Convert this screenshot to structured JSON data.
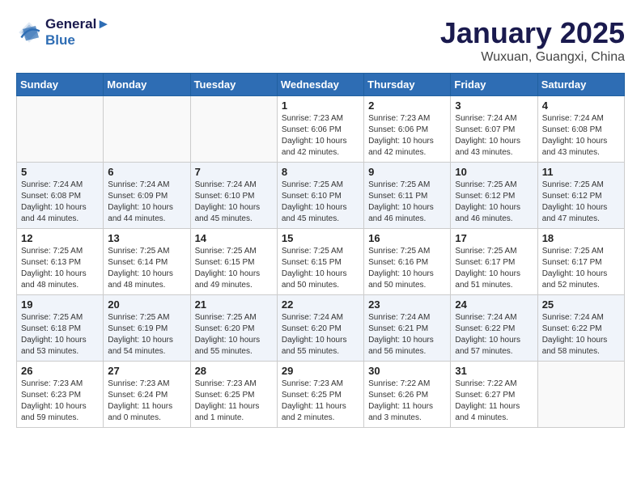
{
  "header": {
    "logo_line1": "General",
    "logo_line2": "Blue",
    "month": "January 2025",
    "location": "Wuxuan, Guangxi, China"
  },
  "weekdays": [
    "Sunday",
    "Monday",
    "Tuesday",
    "Wednesday",
    "Thursday",
    "Friday",
    "Saturday"
  ],
  "weeks": [
    [
      {
        "day": "",
        "info": ""
      },
      {
        "day": "",
        "info": ""
      },
      {
        "day": "",
        "info": ""
      },
      {
        "day": "1",
        "info": "Sunrise: 7:23 AM\nSunset: 6:06 PM\nDaylight: 10 hours\nand 42 minutes."
      },
      {
        "day": "2",
        "info": "Sunrise: 7:23 AM\nSunset: 6:06 PM\nDaylight: 10 hours\nand 42 minutes."
      },
      {
        "day": "3",
        "info": "Sunrise: 7:24 AM\nSunset: 6:07 PM\nDaylight: 10 hours\nand 43 minutes."
      },
      {
        "day": "4",
        "info": "Sunrise: 7:24 AM\nSunset: 6:08 PM\nDaylight: 10 hours\nand 43 minutes."
      }
    ],
    [
      {
        "day": "5",
        "info": "Sunrise: 7:24 AM\nSunset: 6:08 PM\nDaylight: 10 hours\nand 44 minutes."
      },
      {
        "day": "6",
        "info": "Sunrise: 7:24 AM\nSunset: 6:09 PM\nDaylight: 10 hours\nand 44 minutes."
      },
      {
        "day": "7",
        "info": "Sunrise: 7:24 AM\nSunset: 6:10 PM\nDaylight: 10 hours\nand 45 minutes."
      },
      {
        "day": "8",
        "info": "Sunrise: 7:25 AM\nSunset: 6:10 PM\nDaylight: 10 hours\nand 45 minutes."
      },
      {
        "day": "9",
        "info": "Sunrise: 7:25 AM\nSunset: 6:11 PM\nDaylight: 10 hours\nand 46 minutes."
      },
      {
        "day": "10",
        "info": "Sunrise: 7:25 AM\nSunset: 6:12 PM\nDaylight: 10 hours\nand 46 minutes."
      },
      {
        "day": "11",
        "info": "Sunrise: 7:25 AM\nSunset: 6:12 PM\nDaylight: 10 hours\nand 47 minutes."
      }
    ],
    [
      {
        "day": "12",
        "info": "Sunrise: 7:25 AM\nSunset: 6:13 PM\nDaylight: 10 hours\nand 48 minutes."
      },
      {
        "day": "13",
        "info": "Sunrise: 7:25 AM\nSunset: 6:14 PM\nDaylight: 10 hours\nand 48 minutes."
      },
      {
        "day": "14",
        "info": "Sunrise: 7:25 AM\nSunset: 6:15 PM\nDaylight: 10 hours\nand 49 minutes."
      },
      {
        "day": "15",
        "info": "Sunrise: 7:25 AM\nSunset: 6:15 PM\nDaylight: 10 hours\nand 50 minutes."
      },
      {
        "day": "16",
        "info": "Sunrise: 7:25 AM\nSunset: 6:16 PM\nDaylight: 10 hours\nand 50 minutes."
      },
      {
        "day": "17",
        "info": "Sunrise: 7:25 AM\nSunset: 6:17 PM\nDaylight: 10 hours\nand 51 minutes."
      },
      {
        "day": "18",
        "info": "Sunrise: 7:25 AM\nSunset: 6:17 PM\nDaylight: 10 hours\nand 52 minutes."
      }
    ],
    [
      {
        "day": "19",
        "info": "Sunrise: 7:25 AM\nSunset: 6:18 PM\nDaylight: 10 hours\nand 53 minutes."
      },
      {
        "day": "20",
        "info": "Sunrise: 7:25 AM\nSunset: 6:19 PM\nDaylight: 10 hours\nand 54 minutes."
      },
      {
        "day": "21",
        "info": "Sunrise: 7:25 AM\nSunset: 6:20 PM\nDaylight: 10 hours\nand 55 minutes."
      },
      {
        "day": "22",
        "info": "Sunrise: 7:24 AM\nSunset: 6:20 PM\nDaylight: 10 hours\nand 55 minutes."
      },
      {
        "day": "23",
        "info": "Sunrise: 7:24 AM\nSunset: 6:21 PM\nDaylight: 10 hours\nand 56 minutes."
      },
      {
        "day": "24",
        "info": "Sunrise: 7:24 AM\nSunset: 6:22 PM\nDaylight: 10 hours\nand 57 minutes."
      },
      {
        "day": "25",
        "info": "Sunrise: 7:24 AM\nSunset: 6:22 PM\nDaylight: 10 hours\nand 58 minutes."
      }
    ],
    [
      {
        "day": "26",
        "info": "Sunrise: 7:23 AM\nSunset: 6:23 PM\nDaylight: 10 hours\nand 59 minutes."
      },
      {
        "day": "27",
        "info": "Sunrise: 7:23 AM\nSunset: 6:24 PM\nDaylight: 11 hours\nand 0 minutes."
      },
      {
        "day": "28",
        "info": "Sunrise: 7:23 AM\nSunset: 6:25 PM\nDaylight: 11 hours\nand 1 minute."
      },
      {
        "day": "29",
        "info": "Sunrise: 7:23 AM\nSunset: 6:25 PM\nDaylight: 11 hours\nand 2 minutes."
      },
      {
        "day": "30",
        "info": "Sunrise: 7:22 AM\nSunset: 6:26 PM\nDaylight: 11 hours\nand 3 minutes."
      },
      {
        "day": "31",
        "info": "Sunrise: 7:22 AM\nSunset: 6:27 PM\nDaylight: 11 hours\nand 4 minutes."
      },
      {
        "day": "",
        "info": ""
      }
    ]
  ]
}
